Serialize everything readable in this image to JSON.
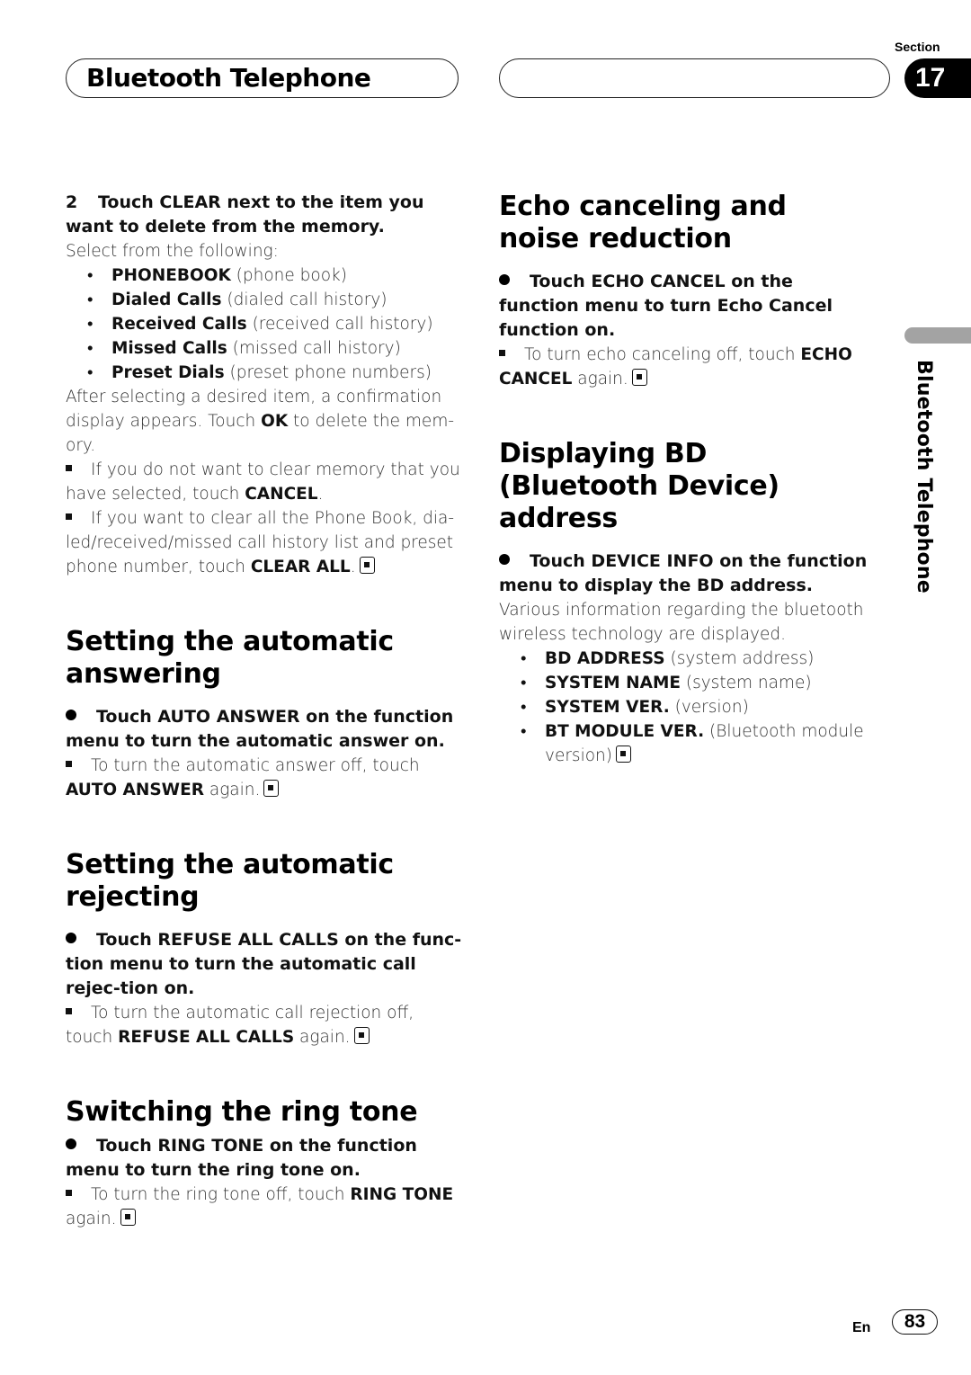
{
  "header": {
    "title": "Bluetooth Telephone",
    "section_label": "Section",
    "section_number": "17"
  },
  "side_tab": {
    "label": "Bluetooth Telephone"
  },
  "left": {
    "step2": {
      "number": "2",
      "text": "Touch CLEAR next to the item you want to delete from the memory.",
      "intro": "Select from the following:",
      "items": [
        {
          "bold": "PHONEBOOK",
          "rest": " (phone book)"
        },
        {
          "bold": "Dialed Calls",
          "rest": " (dialed call history)"
        },
        {
          "bold": "Received Calls",
          "rest": " (received call history)"
        },
        {
          "bold": "Missed Calls",
          "rest": " (missed call history)"
        },
        {
          "bold": "Preset Dials",
          "rest": " (preset phone numbers)"
        }
      ],
      "after_pre": "After selecting a desired item, a confirmation display appears. Touch ",
      "after_bold": "OK",
      "after_post": " to delete the mem-ory.",
      "note1_pre": "If you do not want to clear memory that you have selected, touch ",
      "note1_bold": "CANCEL",
      "note1_post": ".",
      "note2_pre": "If you want to clear all the Phone Book, dia-led/received/missed call history list and preset phone number, touch ",
      "note2_bold": "CLEAR ALL",
      "note2_post": "."
    },
    "auto_answer": {
      "heading": "Setting the automatic answering",
      "instruction": "Touch AUTO ANSWER on the function menu to turn the automatic answer on.",
      "note_pre": "To turn the automatic answer off, touch ",
      "note_bold": "AUTO ANSWER",
      "note_post": " again."
    },
    "auto_reject": {
      "heading": "Setting the automatic rejecting",
      "instruction": "Touch REFUSE ALL CALLS on the func-tion menu to turn the automatic call rejec-tion on.",
      "note_pre": "To turn the automatic call rejection off, touch ",
      "note_bold": "REFUSE ALL CALLS",
      "note_post": " again."
    },
    "ring_tone": {
      "heading": "Switching the ring tone",
      "instruction": "Touch RING TONE on the function menu to turn the ring tone on.",
      "note_pre": "To turn the ring tone off, touch ",
      "note_bold": "RING TONE",
      "note_post": " again."
    }
  },
  "right": {
    "echo": {
      "heading": "Echo canceling and noise reduction",
      "instruction": "Touch ECHO CANCEL on the function menu to turn Echo Cancel function on.",
      "note_pre": "To turn echo canceling off, touch ",
      "note_bold": "ECHO CANCEL",
      "note_post": " again."
    },
    "bd_address": {
      "heading": "Displaying BD (Bluetooth Device) address",
      "instruction": "Touch DEVICE INFO on the function menu to display the BD address.",
      "body": "Various information regarding the bluetooth wireless technology are displayed.",
      "items": [
        {
          "bold": "BD ADDRESS",
          "rest": " (system address)"
        },
        {
          "bold": "SYSTEM NAME",
          "rest": " (system name)"
        },
        {
          "bold": "SYSTEM VER.",
          "rest": " (version)"
        },
        {
          "bold": "BT MODULE VER.",
          "rest": " (Bluetooth module version)"
        }
      ]
    }
  },
  "footer": {
    "language": "En",
    "page_number": "83"
  }
}
